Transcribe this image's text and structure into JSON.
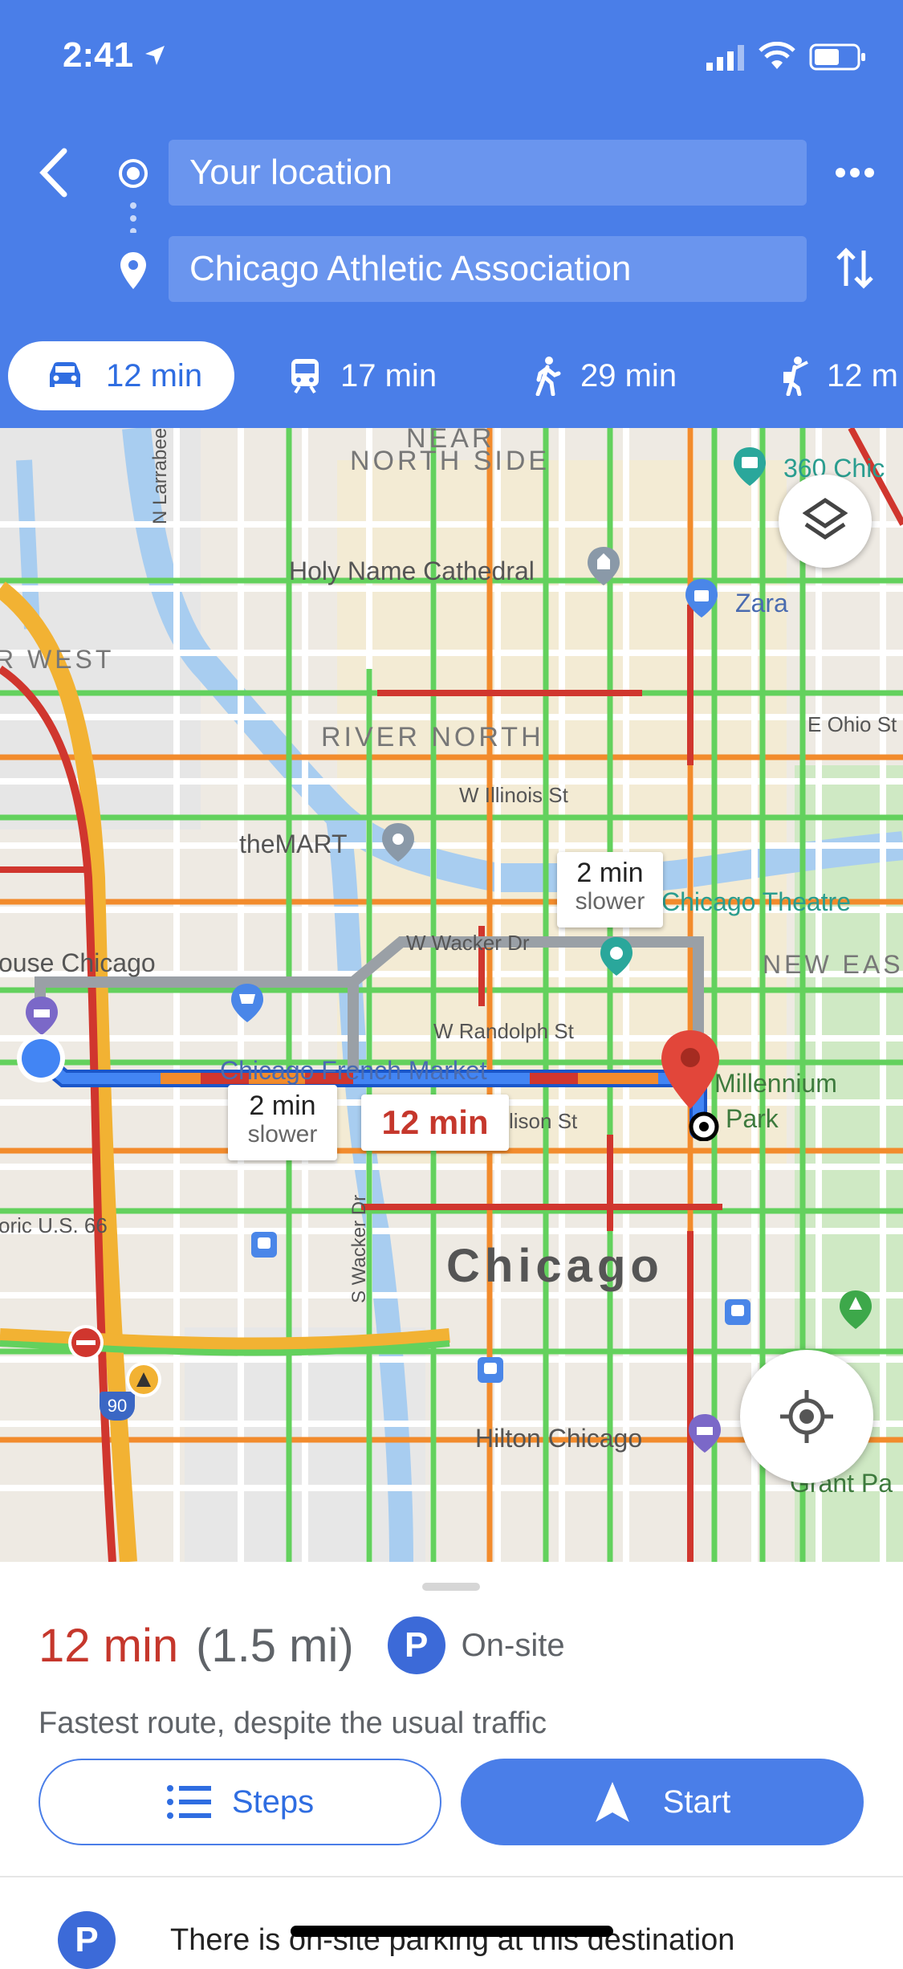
{
  "status_bar": {
    "time": "2:41"
  },
  "search": {
    "origin": "Your location",
    "destination": "Chicago Athletic Association"
  },
  "modes": [
    {
      "icon": "car-icon",
      "label": "12 min"
    },
    {
      "icon": "train-icon",
      "label": "17 min"
    },
    {
      "icon": "walk-icon",
      "label": "29 min"
    },
    {
      "icon": "rideshare-icon",
      "label": "12 m"
    }
  ],
  "map": {
    "labels": {
      "near": "NEAR",
      "north_side": "NORTH SIDE",
      "holy_name": "Holy Name Cathedral",
      "zara": "Zara",
      "chic360": "360 Chic",
      "west": "R WEST",
      "river_north": "RIVER NORTH",
      "e_ohio": "E Ohio St",
      "w_illinois": "W Illinois St",
      "mart": "theMART",
      "house_chicago": "ouse Chicago",
      "w_wacker": "W Wacker Dr",
      "chicago_theatre": "Chicago Theatre",
      "new_east": "NEW EAS",
      "w_randolph": "W Randolph St",
      "french_market": "Chicago French Market",
      "madison": "lison St",
      "millennium": "Millennium",
      "park": "Park",
      "route66": "oric U.S. 66",
      "s_wacker": "S Wacker Dr",
      "chicago": "Chicago",
      "n_larrabee": "N Larrabee",
      "hilton": "Hilton Chicago",
      "grant_park": "Grant Pa",
      "shield_90": "90"
    },
    "bubbles": {
      "alt1_time": "2 min",
      "alt1_note": "slower",
      "alt2_time": "2 min",
      "alt2_note": "slower",
      "main_time": "12 min"
    }
  },
  "summary": {
    "duration": "12 min",
    "distance": "(1.5 mi)",
    "parking_badge": "P",
    "parking_label": "On-site",
    "description": "Fastest route, despite the usual traffic"
  },
  "actions": {
    "steps_label": "Steps",
    "start_label": "Start"
  },
  "parking_note": {
    "badge": "P",
    "text": "There is on-site parking at this destination"
  },
  "colors": {
    "header": "#4a7ee8",
    "route": "#4285f4",
    "traffic_red": "#d0362e",
    "traffic_orange": "#f28b2c",
    "traffic_green": "#63d15d",
    "duration_red": "#c5372c"
  }
}
